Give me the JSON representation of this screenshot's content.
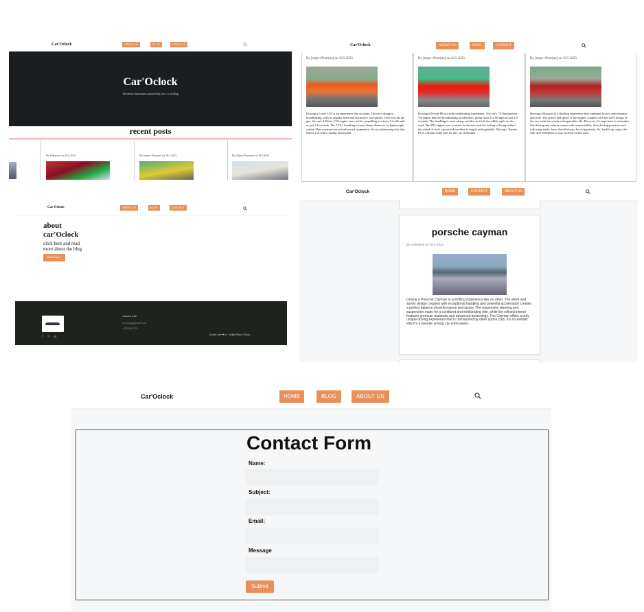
{
  "brand": "Car'Oclock",
  "brand_alt": "Car'Oclock",
  "nav_home": "HOME",
  "nav_about": "ABOUT US",
  "nav_blog": "BLOG",
  "nav_contact": "CONTACT",
  "colors": {
    "accent": "#e8905a",
    "hero_bg": "#1b1e21",
    "footer_bg": "#1e231e",
    "red_line": "#d33b3b"
  },
  "hero": {
    "title": "Car'Oclock",
    "subtitle": "Driven by innovation, powered by you - a car blog"
  },
  "recent_posts": {
    "heading": "recent posts",
    "cards": [
      {
        "meta": "By Unknown on 19.5.2023"
      },
      {
        "meta": "By [object Promise] on 19.5.2023"
      },
      {
        "meta": "By [object Promise] on 19.5.2023"
      }
    ]
  },
  "posts_grid": [
    {
      "meta": "By [object Promise] on 19.5.2023",
      "text": "Driving a Lexus LFA is an experience like no other. The car's design is breathtaking, with its angular lines and distinctive rear spoiler. Once you hit the gas, the car's 4.8-liter V10 engine roars to life, propelling you from 0 to 60 mph in just 3.6 seconds. The LFA's handling is razor-sharp, thanks to its lightweight carbon fiber construction and advanced suspension. It's an exhilarating ride that leaves you with a lasting impression."
    },
    {
      "meta": "By [object Promise] on 19.5.2023",
      "text": "Driving a Ferrari F8 is a truly exhilarating experience. The car's 710 horsepower V8 engine delivers breathtaking acceleration, going from 0 to 60 mph in just 2.9 seconds. The handling is razor-sharp, and the car feels incredibly agile on the road. The F8's engine note is music to the ears, and the feeling of being behind the wheel of such a powerful machine is simply unforgettable. Driving a Ferrari F8 is a dream come true for any car enthusiast."
    },
    {
      "meta": "By [object Promise] on 19.5.2023",
      "text": "Driving a Maserati is a thrilling experience that combines luxury, performance, and style. The power and speed of the engine, coupled with the sleek design of the car, make for a truly unforgettable ride. However, it's important to remember that driving any vehicle comes with responsibility. Safe driving practices and following traffic laws should always be a top priority. So, buckle up, enjoy the ride, and remember to stay focused on the road."
    }
  ],
  "about": {
    "title_line1": "about",
    "title_line2": "car'Oclock",
    "text_line1": "click here and read",
    "text_line2": "more about the blog",
    "button": "Read more"
  },
  "footer": {
    "contact_heading": "contact info",
    "email": "car'oblog@gmail.com",
    "phone": "+4598462158",
    "credit": "Created with ❤ by , Srdjan Mitrov Nikon..",
    "social": [
      "f",
      "t",
      "◎"
    ]
  },
  "article": {
    "title": "porsche cayman",
    "meta": "By undefined on 18.5.2023",
    "text": "Driving a Porsche Cayman is a thrilling experience like no other. The sleek and sporty design coupled with exceptional handling and powerful acceleration creates a perfect balance of performance and luxury. The responsive steering and suspension make for a confident and exhilarating ride, while the refined interior features premium materials and advanced technology. The Cayman offers a truly unique driving experience that is unmatched by other sports cars. It's no wonder why it's a favorite among car enthusiasts."
  },
  "contact_form": {
    "title": "Contact Form",
    "name_label": "Name:",
    "subject_label": "Subject:",
    "email_label": "Email:",
    "message_label": "Message",
    "submit": "Submit"
  }
}
